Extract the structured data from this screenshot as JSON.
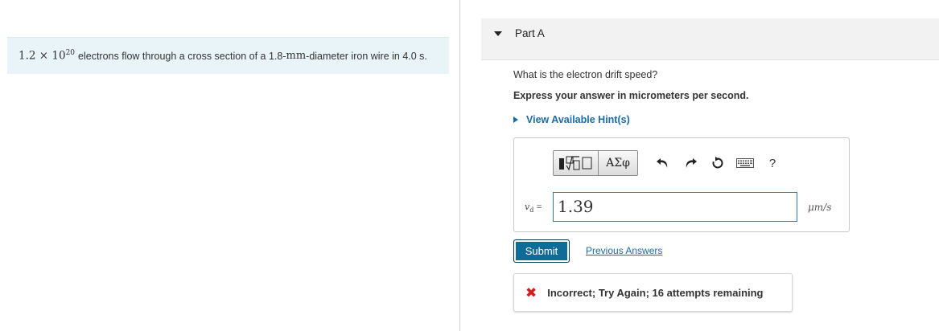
{
  "problem": {
    "coefficient": "1.2",
    "times": "×",
    "base": "10",
    "exponent": "20",
    "text_1": "electrons flow through a cross section of a 1.8-",
    "unit_mm": "mm",
    "text_2": "-diameter iron wire in 4.0 s."
  },
  "part": {
    "title": "Part A"
  },
  "question": "What is the electron drift speed?",
  "instruction": "Express your answer in micrometers per second.",
  "hint_link": "View Available Hint(s)",
  "toolbar": {
    "symbols_label": "ΑΣφ",
    "help_label": "?"
  },
  "answer": {
    "variable": "v",
    "subscript": "d",
    "equals": "=",
    "value": "1.39",
    "unit": "μm/s"
  },
  "submit_label": "Submit",
  "previous_answers_label": "Previous Answers",
  "feedback": {
    "icon": "✖",
    "message": "Incorrect; Try Again; 16 attempts remaining"
  },
  "colors": {
    "problem_bg": "#e8f4f8",
    "link": "#1b6ba5",
    "submit_bg": "#0f6b97",
    "input_border": "#2c7bb5",
    "error": "#d11e1e"
  }
}
